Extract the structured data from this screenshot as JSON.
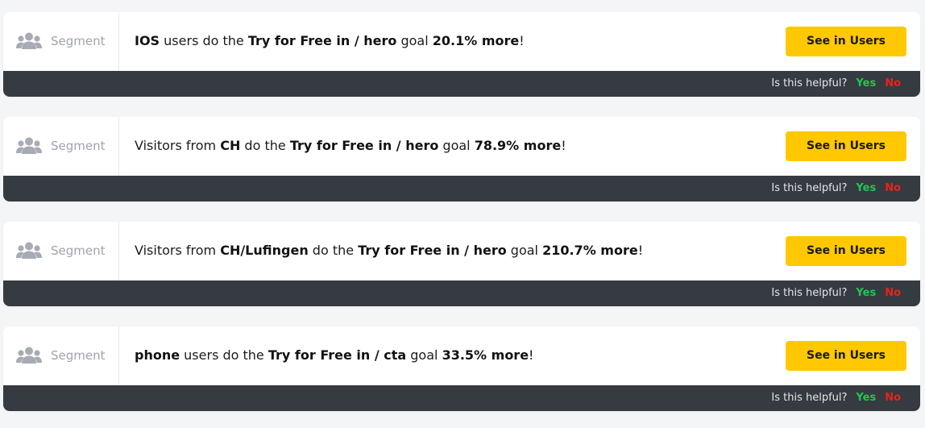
{
  "colors": {
    "page_bg": "#f4f5f7",
    "card_bg": "#ffffff",
    "footer_bg": "#363a41",
    "accent_button": "#ffc800",
    "yes_color": "#23c552",
    "no_color": "#e8221b",
    "segment_muted": "#a0a4ad"
  },
  "cards": [
    {
      "segment_icon": "users-group-icon",
      "segment_label": "Segment",
      "insight": {
        "subject": "IOS",
        "lead": "",
        "mid": " users do the ",
        "goal": "Try for Free in / hero",
        "goal_word": " goal ",
        "delta": "20.1% more",
        "end": "!"
      },
      "button_label": "See in Users",
      "feedback": {
        "question": "Is this helpful?",
        "yes": "Yes",
        "no": "No"
      }
    },
    {
      "segment_icon": "users-group-icon",
      "segment_label": "Segment",
      "insight": {
        "subject": "CH",
        "lead": "Visitors from ",
        "mid": " do the ",
        "goal": "Try for Free in / hero",
        "goal_word": " goal ",
        "delta": "78.9% more",
        "end": "!"
      },
      "button_label": "See in Users",
      "feedback": {
        "question": "Is this helpful?",
        "yes": "Yes",
        "no": "No"
      }
    },
    {
      "segment_icon": "users-group-icon",
      "segment_label": "Segment",
      "insight": {
        "subject": "CH/Lufingen",
        "lead": "Visitors from ",
        "mid": " do the ",
        "goal": "Try for Free in / hero",
        "goal_word": " goal ",
        "delta": "210.7% more",
        "end": "!"
      },
      "button_label": "See in Users",
      "feedback": {
        "question": "Is this helpful?",
        "yes": "Yes",
        "no": "No"
      }
    },
    {
      "segment_icon": "users-group-icon",
      "segment_label": "Segment",
      "insight": {
        "subject": "phone",
        "lead": "",
        "mid": " users do the ",
        "goal": "Try for Free in / cta",
        "goal_word": " goal ",
        "delta": "33.5% more",
        "end": "!"
      },
      "button_label": "See in Users",
      "feedback": {
        "question": "Is this helpful?",
        "yes": "Yes",
        "no": "No"
      }
    }
  ]
}
